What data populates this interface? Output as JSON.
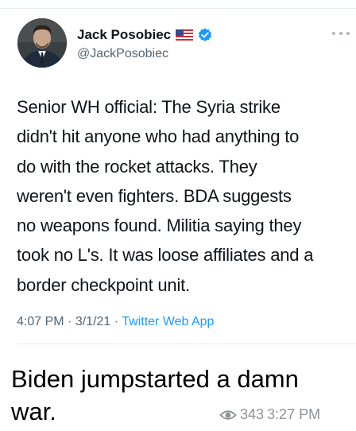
{
  "tweet": {
    "display_name": "Jack Posobiec",
    "flag": "us-flag-icon",
    "verified": "verified-badge-icon",
    "handle": "@JackPosobiec",
    "more": "more-options-icon",
    "text_lines": [
      "Senior WH official: The Syria strike",
      "didn't hit anyone who had anything to",
      "do with the rocket attacks. They",
      "weren't even fighters. BDA suggests",
      "no weapons found. Militia saying they",
      "took no L's. It was loose affiliates and a",
      "border checkpoint unit."
    ],
    "time": "4:07 PM",
    "separator": "·",
    "date": "3/1/21",
    "source": "Twitter Web App"
  },
  "message": {
    "text_lines": [
      "Biden jumpstarted a damn",
      "war."
    ],
    "views": "343",
    "time": "3:27 PM"
  },
  "colors": {
    "text": "#0f1419",
    "secondary": "#536471",
    "link": "#1d9bf0",
    "verified": "#1d9bf0",
    "divider": "#e6ecf0",
    "message_meta": "#8e9396"
  }
}
